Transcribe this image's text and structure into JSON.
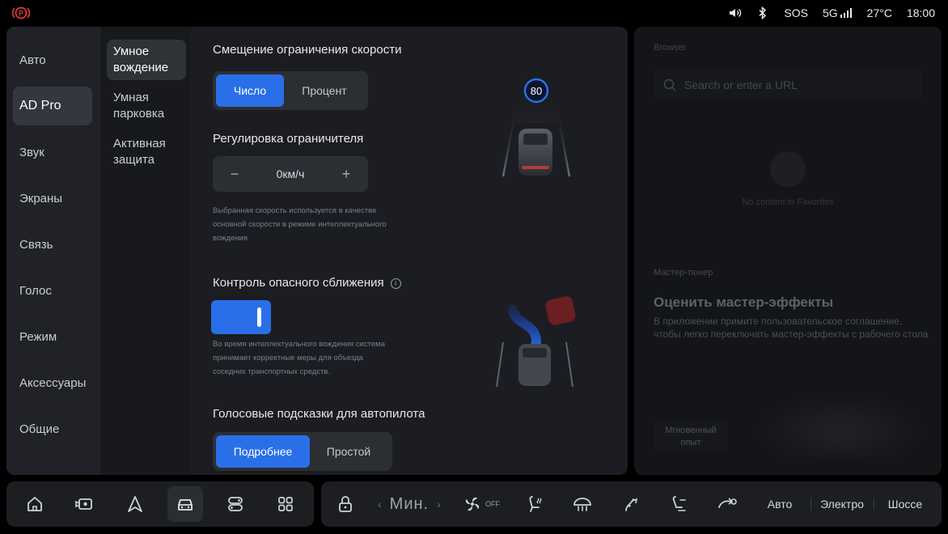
{
  "status": {
    "sos": "SOS",
    "network": "5G",
    "temperature": "27°C",
    "time": "18:00",
    "icons": [
      "parking-brake-icon",
      "volume-icon",
      "bluetooth-icon",
      "signal-icon"
    ]
  },
  "nav_primary": {
    "items": [
      "Авто",
      "AD Pro",
      "Звук",
      "Экраны",
      "Связь",
      "Голос",
      "Режим",
      "Аксессуары",
      "Общие"
    ],
    "active": "AD Pro"
  },
  "nav_secondary": {
    "items": [
      {
        "line1": "Умное",
        "line2": "вождение"
      },
      {
        "line1": "Умная",
        "line2": "парковка"
      },
      {
        "line1": "Активная",
        "line2": "защита"
      }
    ],
    "active": "Умное вождение"
  },
  "speed_offset": {
    "title": "Смещение ограничения скорости",
    "options": [
      "Число",
      "Процент"
    ],
    "selected": "Число",
    "sign_value": "80"
  },
  "limiter": {
    "title": "Регулировка ограничителя",
    "minus": "−",
    "plus": "+",
    "value": "0км/ч",
    "hint_line1": "Выбранная скорость используется в качестве",
    "hint_line2": "основной скорости в режиме интеллектуального",
    "hint_line3": "вождения"
  },
  "collision": {
    "title": "Контроль опасного сближения",
    "enabled": true,
    "hint_line1": "Во время интеллектуального вождения система",
    "hint_line2": "принимает корректные меры для объезда",
    "hint_line3": "соседних транспортных средств."
  },
  "voice_hints": {
    "title": "Голосовые подсказки для автопилота",
    "options": [
      "Подробнее",
      "Простой"
    ],
    "selected": "Подробнее"
  },
  "browser": {
    "label": "Browser",
    "search_placeholder": "Search or enter a URL",
    "empty_text": "No content in Favorites"
  },
  "master_tuner": {
    "label": "Мастер-тюнер",
    "title": "Оценить мастер-эффекты",
    "desc_line1": "В приложении примите пользовательское соглашение,",
    "desc_line2": "чтобы легко переключать мастер-эффекты с рабочего стола",
    "button_line1": "Мгновенный",
    "button_line2": "опыт"
  },
  "dock": {
    "apps": [
      "home-icon",
      "dashcam-icon",
      "navigation-icon",
      "car-icon",
      "media-icon",
      "apps-grid-icon"
    ],
    "active_app": "car-icon",
    "climate": {
      "fan_value": "Мин.",
      "fan_state": "OFF",
      "modes": [
        "Авто",
        "Электро",
        "Шоссе"
      ]
    }
  },
  "colors": {
    "accent": "#2a6fe8",
    "panel": "#1b1d22",
    "background": "#000000"
  }
}
